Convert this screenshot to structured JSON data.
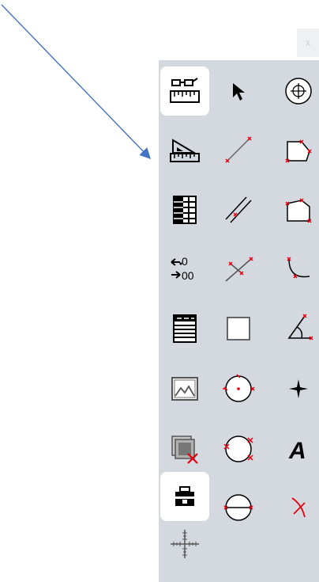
{
  "window": {
    "close_glyph": "x"
  },
  "toolbar": {
    "columns": [
      {
        "tools": [
          "measure-glasses-ruler-icon",
          "ruler-triangle-icon",
          "table-grid-icon",
          "decimal-places-icon",
          "list-lines-icon",
          "image-icon",
          "layer-delete-icon",
          "camera-lock-icon",
          "crosshair-scale-icon"
        ]
      },
      {
        "tools": [
          "pointer-arrow-icon",
          "line-icon",
          "parallel-lines-icon",
          "perpendicular-lines-icon",
          "rectangle-icon",
          "circle-center-icon",
          "circle-points-icon",
          "circle-diameter-icon"
        ]
      },
      {
        "tools": [
          "circle-target-icon",
          "polygon-angle-icon",
          "polygon-icon",
          "arc-icon",
          "angle-icon",
          "point-cross-icon",
          "text-tool-icon",
          "intersection-icon"
        ]
      }
    ],
    "text_tool_label": "A",
    "decimal_labels": [
      "0",
      "00"
    ]
  },
  "colors": {
    "toolbar_bg": "#d4d9e0",
    "selected_bg": "#ffffff",
    "arrow": "#4472c4",
    "accent_red": "#e8000e"
  }
}
